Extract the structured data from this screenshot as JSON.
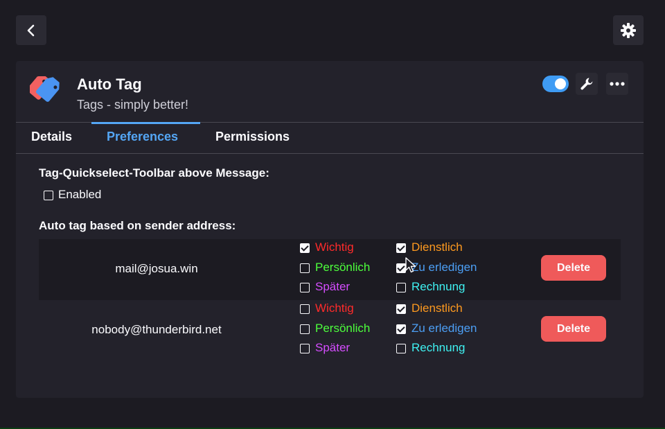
{
  "colors": {
    "accent": "#54a6f4",
    "delete": "#ef5a5a",
    "tag_wichtig": "#ff2b2b",
    "tag_persoenlich": "#4dff3c",
    "tag_spaeter": "#d54dff",
    "tag_dienstlich": "#ff9a1f",
    "tag_zu_erledigen": "#4c9ff5",
    "tag_rechnung": "#3ff2f2"
  },
  "icons": {
    "back": "chevron-left-icon",
    "settings": "gear-icon",
    "addon": "tags-icon",
    "options": "wrench-icon",
    "more": "more-icon"
  },
  "addon": {
    "name": "Auto Tag",
    "description": "Tags - simply better!",
    "enabled": true
  },
  "tabs": [
    {
      "label": "Details",
      "active": false
    },
    {
      "label": "Preferences",
      "active": true
    },
    {
      "label": "Permissions",
      "active": false
    }
  ],
  "preferences": {
    "toolbar_heading": "Tag-Quickselect-Toolbar above Message:",
    "toolbar_enabled_label": "Enabled",
    "toolbar_enabled": false,
    "sender_heading": "Auto tag based on sender address:"
  },
  "rules": [
    {
      "email": "mail@josua.win",
      "delete_label": "Delete",
      "tags": [
        {
          "label": "Wichtig",
          "checked": true
        },
        {
          "label": "Persönlich",
          "checked": false
        },
        {
          "label": "Später",
          "checked": false
        },
        {
          "label": "Dienstlich",
          "checked": true
        },
        {
          "label": "Zu erledigen",
          "checked": true
        },
        {
          "label": "Rechnung",
          "checked": false
        }
      ]
    },
    {
      "email": "nobody@thunderbird.net",
      "delete_label": "Delete",
      "tags": [
        {
          "label": "Wichtig",
          "checked": false
        },
        {
          "label": "Persönlich",
          "checked": false
        },
        {
          "label": "Später",
          "checked": false
        },
        {
          "label": "Dienstlich",
          "checked": true
        },
        {
          "label": "Zu erledigen",
          "checked": true
        },
        {
          "label": "Rechnung",
          "checked": false
        }
      ]
    }
  ]
}
